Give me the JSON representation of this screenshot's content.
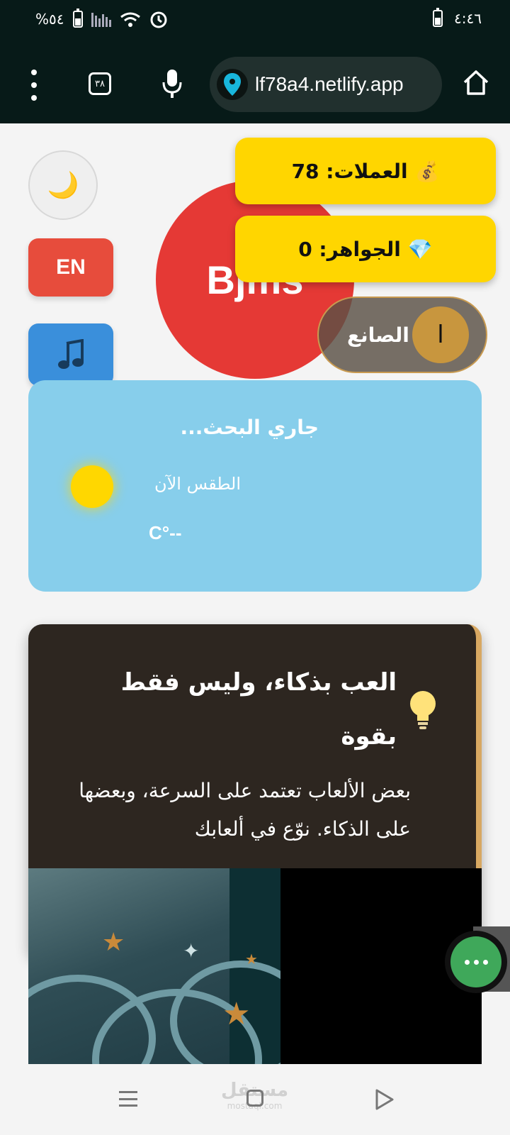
{
  "status_bar": {
    "battery_percent": "%٥٤",
    "time": "٤:٤٦"
  },
  "browser": {
    "tab_count": "٣٨",
    "url": "lf78a4.netlify.app"
  },
  "sidebar": {
    "theme_icon": "moon-icon",
    "language_button": "EN",
    "music_icon": "music-note-icon"
  },
  "header": {
    "logo_text": "Bjms",
    "coins": {
      "label": "العملات: 78",
      "icon": "money-bag-icon"
    },
    "gems": {
      "label": "الجواهر: 0",
      "icon": "gem-icon"
    },
    "maker": {
      "label": "الصانع",
      "avatar_letter": "ا"
    }
  },
  "weather": {
    "title": "جاري البحث...",
    "subtitle": "الطقس الآن",
    "temperature": "C°--"
  },
  "tip": {
    "title": "العب بذكاء، وليس فقط بقوة",
    "body": "بعض الألعاب تعتمد على السرعة، وبعضها على الذكاء. نوّع في ألعابك"
  },
  "fab": {
    "icon": "more-dots-icon"
  },
  "nav_bar": {
    "watermark": "مستقل",
    "watermark_sub": "mostaql.com"
  },
  "colors": {
    "coins_bg": "#ffd600",
    "logo_bg": "#e53935",
    "weather_bg": "#87ceeb",
    "tip_bg": "#2d2620",
    "fab_bg": "#3fa85a"
  }
}
